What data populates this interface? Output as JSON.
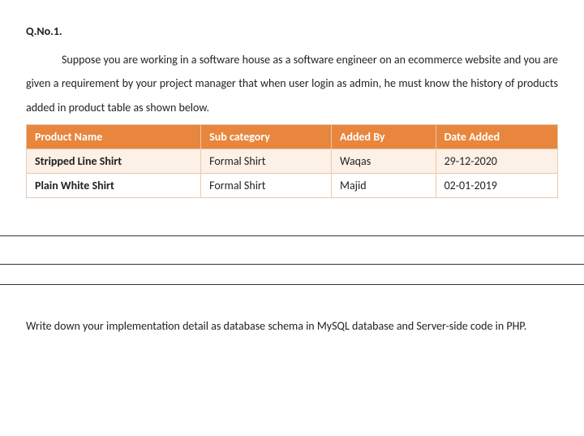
{
  "question": {
    "number": "Q.No.1.",
    "prompt": "Suppose you are working in a software house as a software engineer on an ecommerce website and you are given a requirement by your project manager that when user login as admin, he must know the history of products added in product table as shown below."
  },
  "table": {
    "headers": [
      "Product Name",
      "Sub category",
      "Added By",
      "Date Added"
    ],
    "rows": [
      [
        "Stripped Line Shirt",
        "Formal Shirt",
        "Waqas",
        "29-12-2020"
      ],
      [
        "Plain White Shirt",
        "Formal Shirt",
        "Majid",
        "02-01-2019"
      ]
    ]
  },
  "followup": "Write down your implementation detail as database schema in MySQL database and Server-side code in PHP."
}
